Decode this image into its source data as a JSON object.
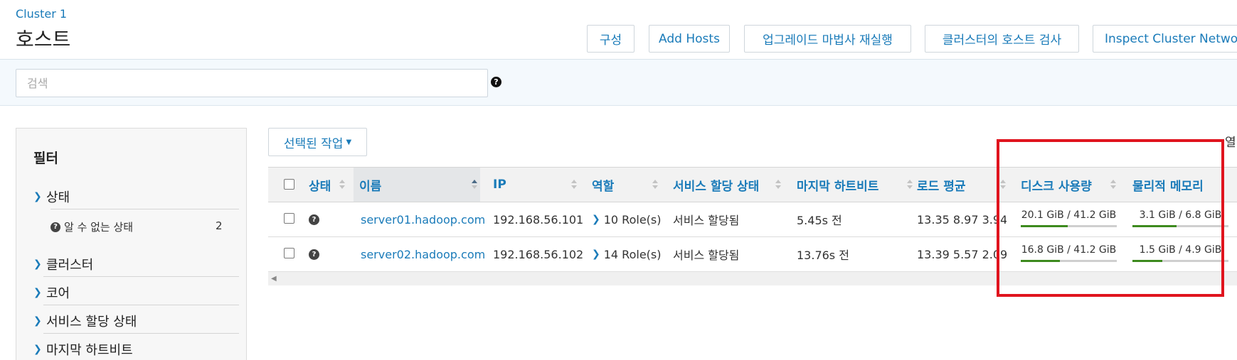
{
  "header": {
    "cluster_link": "Cluster 1",
    "page_title": "호스트",
    "buttons": {
      "configure": "구성",
      "add_hosts": "Add Hosts",
      "rerun_upgrade_wizard": "업그레이드 마법사 재실행",
      "inspect_hosts": "클러스터의 호스트 검사",
      "inspect_network": "Inspect Cluster Network"
    }
  },
  "search": {
    "placeholder": "검색",
    "value": ""
  },
  "filters": {
    "title": "필터",
    "groups": [
      {
        "label": "상태",
        "expanded": true
      },
      {
        "label": "클러스터",
        "expanded": false
      },
      {
        "label": "코어",
        "expanded": false
      },
      {
        "label": "서비스 할당 상태",
        "expanded": false
      },
      {
        "label": "마지막 하트비트",
        "expanded": false
      }
    ],
    "status_option": {
      "label": "알 수 없는 상태",
      "count": "2"
    }
  },
  "toolbar": {
    "actions_label": "선택된 작업",
    "columns_label": "열"
  },
  "table": {
    "columns": {
      "status": "상태",
      "name": "이름",
      "ip": "IP",
      "roles": "역할",
      "commission_state": "서비스 할당 상태",
      "last_heartbeat": "마지막 하트비트",
      "load_average": "로드 평균",
      "disk_usage": "디스크 사용량",
      "physical_memory": "물리적 메모리"
    },
    "rows": [
      {
        "name": "server01.hadoop.com",
        "ip": "192.168.56.101",
        "roles": "10 Role(s)",
        "commission_state": "서비스 할당됨",
        "last_heartbeat": "5.45s 전",
        "load_average": "13.35  8.97  3.94",
        "disk_usage": "20.1 GiB / 41.2 GiB",
        "disk_fraction": 0.49,
        "memory": "3.1 GiB / 6.8 GiB",
        "memory_fraction": 0.46
      },
      {
        "name": "server02.hadoop.com",
        "ip": "192.168.56.102",
        "roles": "14 Role(s)",
        "commission_state": "서비스 할당됨",
        "last_heartbeat": "13.76s 전",
        "load_average": "13.39  5.57  2.09",
        "disk_usage": "16.8 GiB / 41.2 GiB",
        "disk_fraction": 0.41,
        "memory": "1.5 GiB / 4.9 GiB",
        "memory_fraction": 0.31
      }
    ]
  },
  "colors": {
    "link": "#1a7bb9",
    "bar_fill": "#3d8a1e",
    "highlight": "#e0141e"
  }
}
